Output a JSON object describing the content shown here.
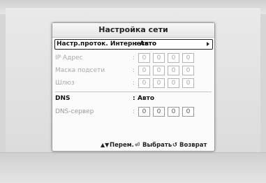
{
  "dialog": {
    "title": "Настройка сети",
    "protocol": {
      "label": "Настр.проток. Интернета",
      "value": "Авто"
    },
    "ip": {
      "label": "IP Адрес",
      "octets": [
        "0",
        "0",
        "0",
        "0"
      ]
    },
    "mask": {
      "label": "Маска подсети",
      "octets": [
        "0",
        "0",
        "0",
        "0"
      ]
    },
    "gateway": {
      "label": "Шлюз",
      "octets": [
        "0",
        "0",
        "0",
        "0"
      ]
    },
    "dns": {
      "label": "DNS",
      "value": "Авто"
    },
    "dns_server": {
      "label": "DNS-сервер",
      "octets": [
        "0",
        "0",
        "0",
        "0"
      ]
    },
    "colon": ":"
  },
  "footer": {
    "move": "Перем.",
    "select": "Выбрать",
    "back": "Возврат",
    "move_icon": "▲▼",
    "select_icon": "⏎",
    "back_icon": "↺"
  },
  "colors": {
    "selected_border": "#222222",
    "disabled_text": "#a8a8a8",
    "dialog_bg": "#fbfbfb"
  },
  "icons": [
    "up-down-arrows-icon",
    "enter-icon",
    "return-icon",
    "chevron-right-icon"
  ]
}
